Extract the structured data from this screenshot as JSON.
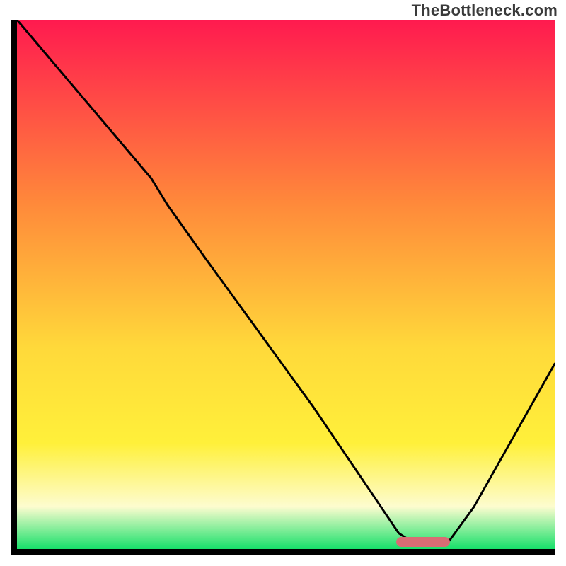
{
  "watermark": "TheBottleneck.com",
  "colors": {
    "top": "#ff1a4f",
    "mid1": "#ff8a3a",
    "mid2": "#ffd93a",
    "mid3": "#fff03a",
    "pale": "#fdfccf",
    "green": "#17e06a",
    "marker": "#d96c74",
    "axis": "#000000"
  },
  "marker": {
    "x_pct_start": 70.5,
    "x_pct_end": 80.5,
    "y_pct": 98.6
  },
  "chart_data": {
    "type": "line",
    "title": "",
    "xlabel": "",
    "ylabel": "",
    "xlim": [
      0,
      100
    ],
    "ylim": [
      0,
      100
    ],
    "x": [
      0,
      5,
      10,
      15,
      20,
      25,
      28,
      35,
      45,
      55,
      65,
      71,
      74,
      80,
      85,
      90,
      95,
      100
    ],
    "values": [
      100,
      94,
      88,
      82,
      76,
      70,
      65,
      55,
      41,
      27,
      12,
      3,
      1,
      1,
      8,
      17,
      26,
      35
    ],
    "marker_range_x": [
      71,
      80
    ],
    "notes": "Gradient background from red (top) through orange/yellow to green (bottom). Black V-shaped curve with minimum near x≈74–80%. Small pink pill marker at the minimum on the baseline."
  }
}
